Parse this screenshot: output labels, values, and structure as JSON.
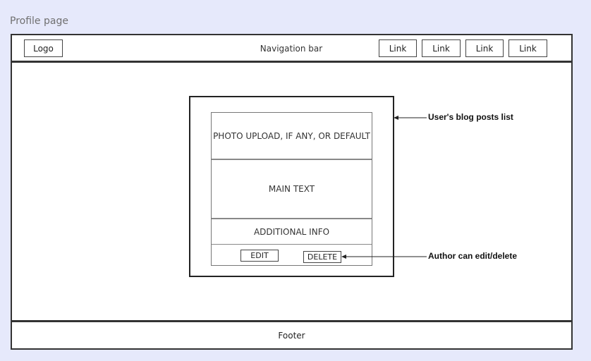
{
  "page_title": "Profile page",
  "nav": {
    "logo": "Logo",
    "label": "Navigation bar",
    "links": [
      "Link",
      "Link",
      "Link",
      "Link"
    ]
  },
  "card": {
    "photo": "PHOTO UPLOAD, IF ANY, OR DEFAULT",
    "main_text": "MAIN TEXT",
    "additional": "ADDITIONAL INFO",
    "edit": "EDIT",
    "delete": "DELETE"
  },
  "annotations": {
    "posts_list": "User's blog posts list",
    "edit_delete": "Author can edit/delete"
  },
  "footer": "Footer"
}
